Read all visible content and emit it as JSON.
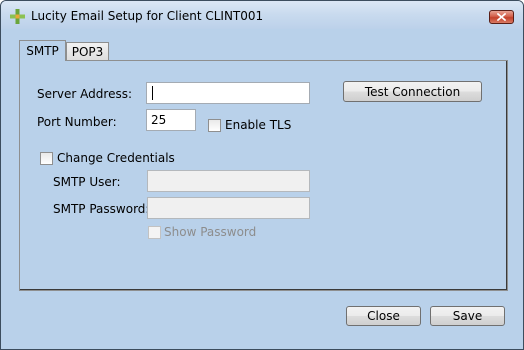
{
  "window": {
    "title": "Lucity Email Setup for Client CLINT001",
    "app_icon": "lucity-cross-icon",
    "close_icon": "close-icon"
  },
  "tabs": [
    {
      "label": "SMTP",
      "selected": true
    },
    {
      "label": "POP3",
      "selected": false
    }
  ],
  "smtp": {
    "server_address_label": "Server Address:",
    "server_address_value": "",
    "port_number_label": "Port Number:",
    "port_number_value": "25",
    "enable_tls_label": "Enable TLS",
    "enable_tls_checked": false,
    "test_connection_label": "Test Connection",
    "change_credentials_label": "Change Credentials",
    "change_credentials_checked": false,
    "smtp_user_label": "SMTP User:",
    "smtp_user_value": "",
    "smtp_password_label": "SMTP Password:",
    "smtp_password_value": "",
    "show_password_label": "Show Password",
    "show_password_checked": false
  },
  "footer": {
    "close_label": "Close",
    "save_label": "Save"
  },
  "colors": {
    "window_background": "#b9d1ea",
    "disabled_text": "#8d8d8d",
    "close_button": "#c3402a"
  }
}
